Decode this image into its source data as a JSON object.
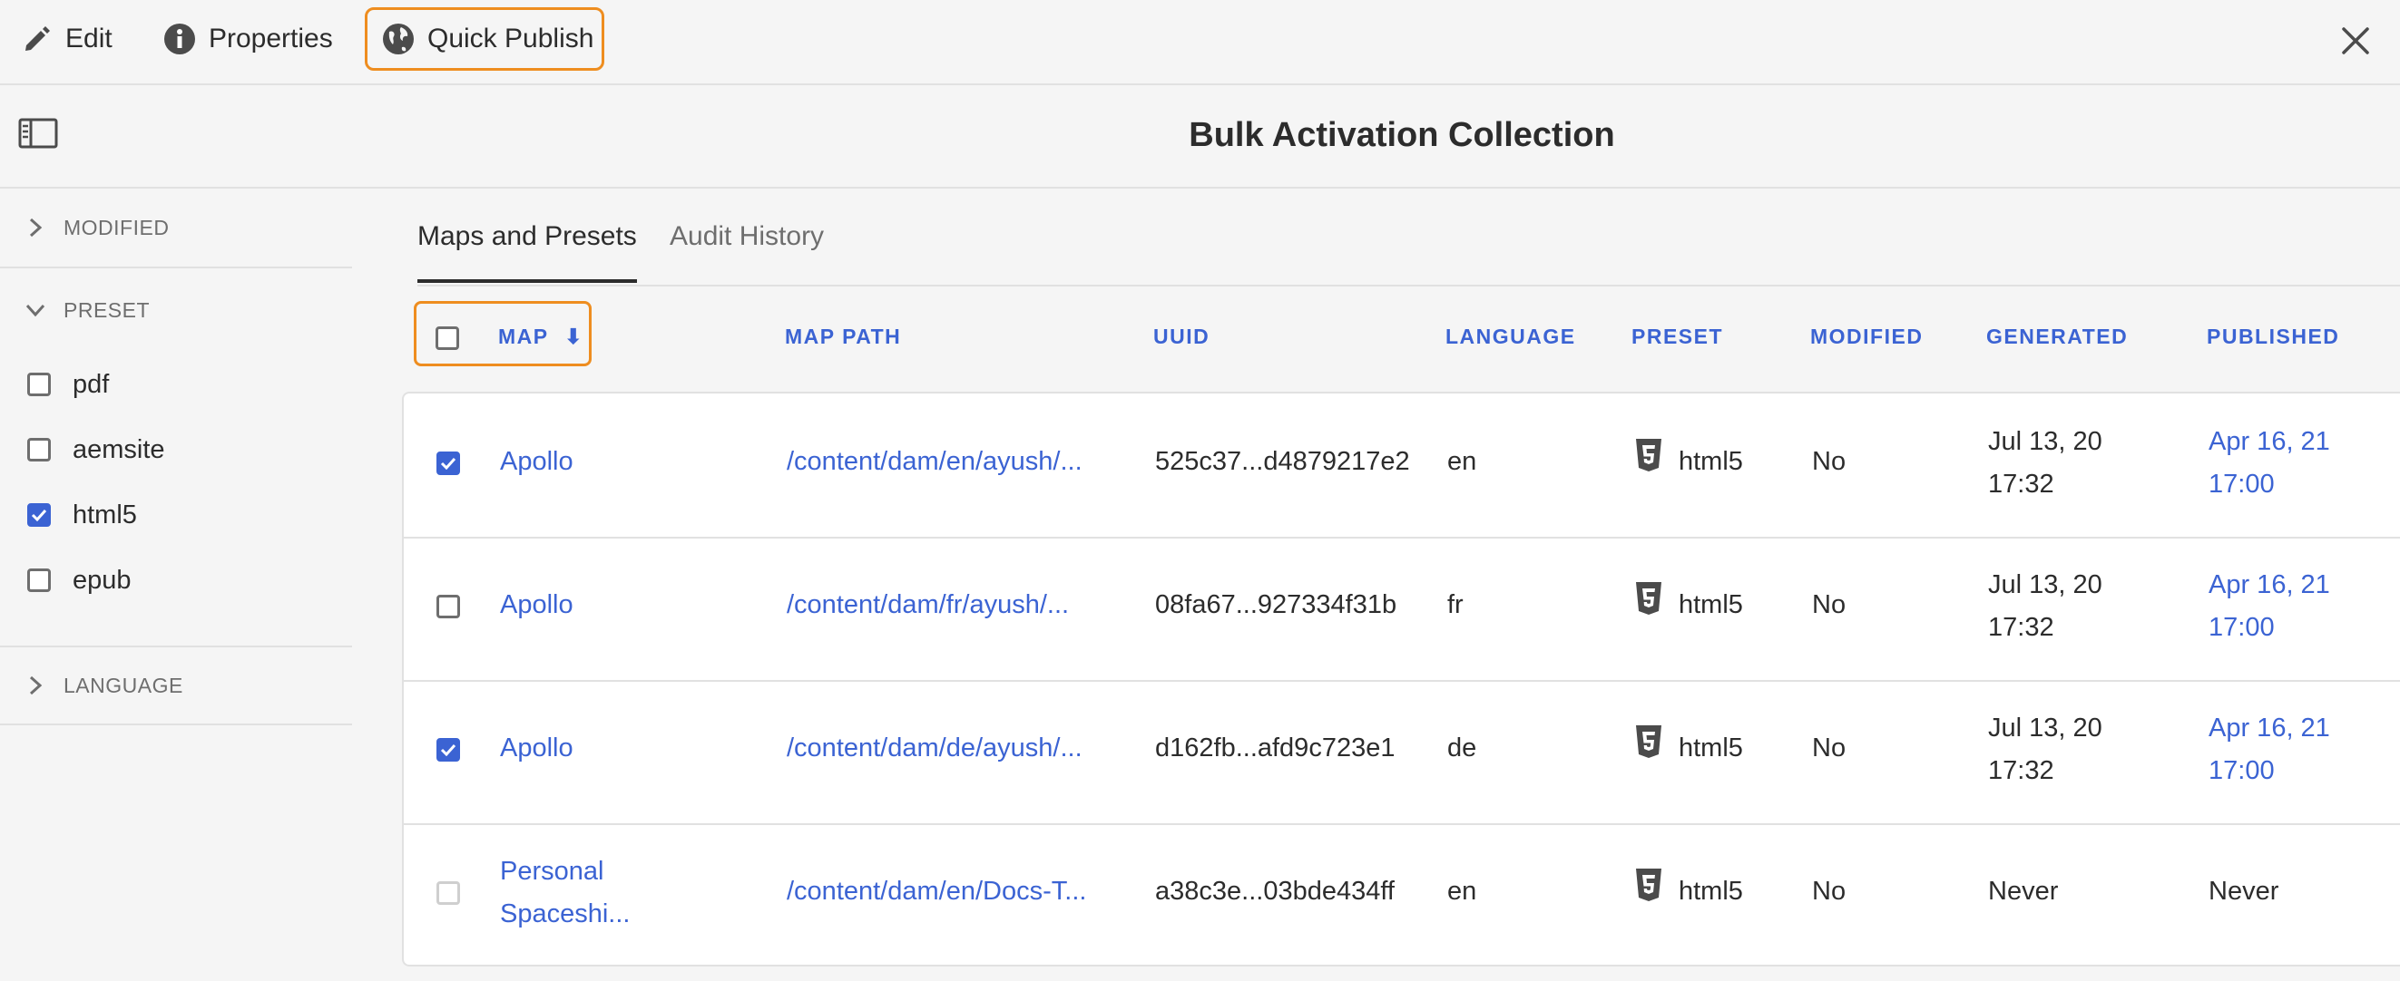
{
  "toolbar": {
    "edit_label": "Edit",
    "properties_label": "Properties",
    "quick_publish_label": "Quick Publish"
  },
  "page": {
    "title": "Bulk Activation Collection"
  },
  "filters": {
    "modified_label": "MODIFIED",
    "preset_label": "PRESET",
    "language_label": "LANGUAGE",
    "preset_options": [
      {
        "label": "pdf",
        "checked": false
      },
      {
        "label": "aemsite",
        "checked": false
      },
      {
        "label": "html5",
        "checked": true
      },
      {
        "label": "epub",
        "checked": false
      }
    ]
  },
  "tabs": [
    {
      "label": "Maps and Presets",
      "selected": true
    },
    {
      "label": "Audit History",
      "selected": false
    }
  ],
  "table": {
    "columns": {
      "map": "MAP",
      "map_path": "MAP PATH",
      "uuid": "UUID",
      "language": "LANGUAGE",
      "preset": "PRESET",
      "modified": "MODIFIED",
      "generated": "GENERATED",
      "published": "PUBLISHED"
    },
    "sort_indicator": "⬇",
    "rows": [
      {
        "checked": true,
        "map_line1": "Apollo",
        "map_line2": "",
        "map_path": "/content/dam/en/ayush/...",
        "uuid": "525c37...d4879217e2",
        "language": "en",
        "preset": "html5",
        "modified": "No",
        "generated_line1": "Jul 13, 20",
        "generated_line2": "17:32",
        "published_line1": "Apr 16, 21",
        "published_line2": "17:00"
      },
      {
        "checked": false,
        "map_line1": "Apollo",
        "map_line2": "",
        "map_path": "/content/dam/fr/ayush/...",
        "uuid": "08fa67...927334f31b",
        "language": "fr",
        "preset": "html5",
        "modified": "No",
        "generated_line1": "Jul 13, 20",
        "generated_line2": "17:32",
        "published_line1": "Apr 16, 21",
        "published_line2": "17:00"
      },
      {
        "checked": true,
        "map_line1": "Apollo",
        "map_line2": "",
        "map_path": "/content/dam/de/ayush/...",
        "uuid": "d162fb...afd9c723e1",
        "language": "de",
        "preset": "html5",
        "modified": "No",
        "generated_line1": "Jul 13, 20",
        "generated_line2": "17:32",
        "published_line1": "Apr 16, 21",
        "published_line2": "17:00"
      },
      {
        "checked": false,
        "disabled": true,
        "map_line1": "Personal",
        "map_line2": "Spaceshi...",
        "map_path": "/content/dam/en/Docs-T...",
        "uuid": "a38c3e...03bde434ff",
        "language": "en",
        "preset": "html5",
        "modified": "No",
        "generated_line1": "Never",
        "generated_line2": "",
        "published_line1": "Never",
        "published_line2": ""
      }
    ]
  },
  "colors": {
    "accent": "#3b63d3",
    "highlight": "#ee8d1f",
    "background": "#f5f5f5"
  }
}
